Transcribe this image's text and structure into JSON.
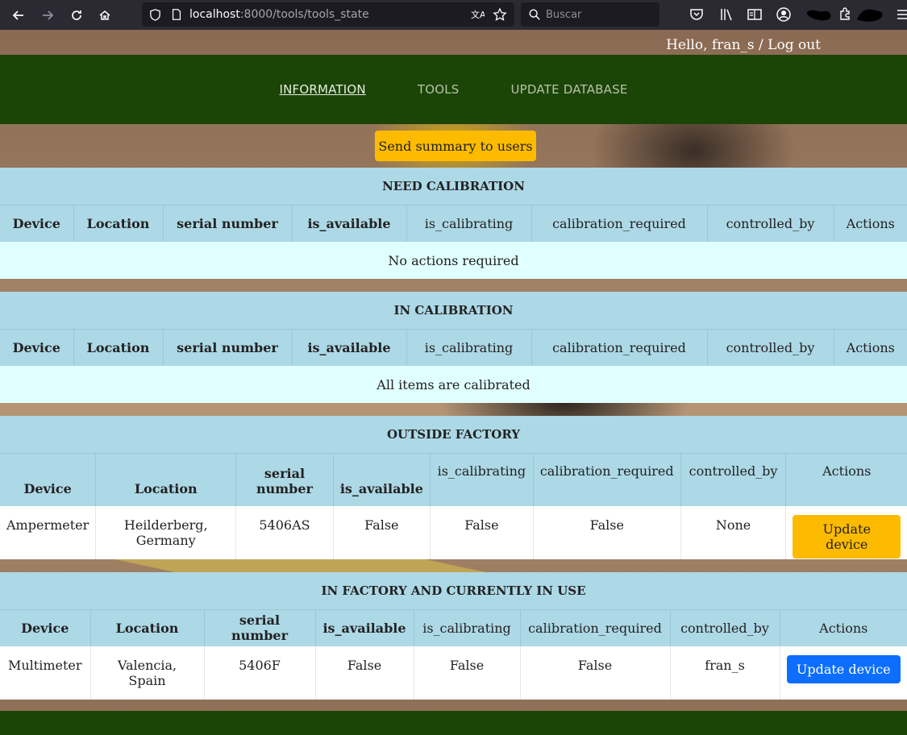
{
  "browser": {
    "url_host": "localhost",
    "url_path": ":8000/tools/tools_state",
    "search_placeholder": "Buscar"
  },
  "user_bar": {
    "greeting": "Hello, fran_s",
    "separator": " / ",
    "logout": "Log out"
  },
  "nav": {
    "items": [
      "INFORMATION",
      "TOOLS",
      "UPDATE DATABASE"
    ]
  },
  "summary_button": "Send summary to users",
  "headers": [
    "Device",
    "Location",
    "serial number",
    "is_available",
    "is_calibrating",
    "calibration_required",
    "controlled_by",
    "Actions"
  ],
  "tables": {
    "need_calibration": {
      "title": "NEED CALIBRATION",
      "empty_text": "No actions required"
    },
    "in_calibration": {
      "title": "IN CALIBRATION",
      "empty_text": "All items are calibrated"
    },
    "outside_factory": {
      "title": "OUTSIDE FACTORY",
      "rows": [
        {
          "device": "Ampermeter",
          "location": "Heilderberg, Germany",
          "serial": "5406AS",
          "is_available": "False",
          "is_calibrating": "False",
          "calibration_required": "False",
          "controlled_by": "None",
          "action": "Update device"
        }
      ]
    },
    "in_factory": {
      "title": "IN FACTORY AND CURRENTLY IN USE",
      "rows": [
        {
          "device": "Multimeter",
          "location": "Valencia, Spain",
          "serial": "5406F",
          "is_available": "False",
          "is_calibrating": "False",
          "calibration_required": "False",
          "controlled_by": "fran_s",
          "action": "Update device"
        }
      ]
    }
  },
  "colors": {
    "nav_green": "#1b4407",
    "header_blue": "#add8e6",
    "empty_cyan": "#e0ffff",
    "btn_yellow": "#fdbb00",
    "btn_blue": "#0d6efd"
  }
}
